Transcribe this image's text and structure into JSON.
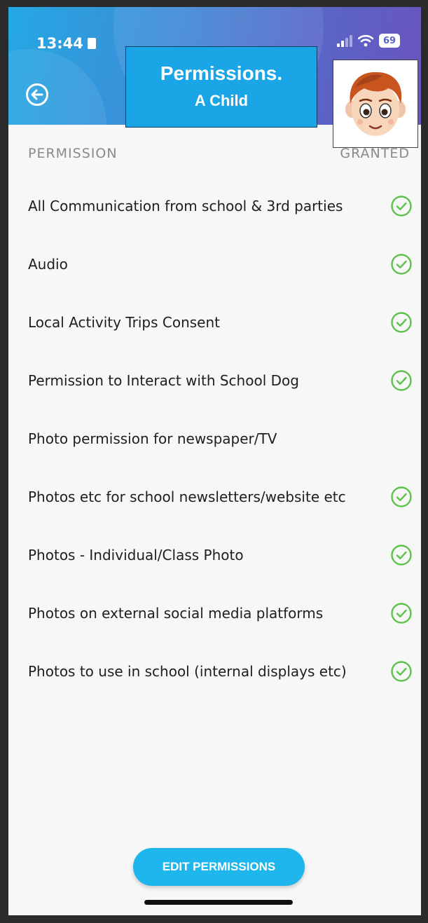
{
  "status_bar": {
    "time": "13:44",
    "battery": "69"
  },
  "header": {
    "title": "Permissions.",
    "subtitle": "A Child"
  },
  "list_header": {
    "left": "PERMISSION",
    "right": "GRANTED"
  },
  "permissions": [
    {
      "label": "All Communication from school & 3rd parties",
      "granted": true
    },
    {
      "label": "Audio",
      "granted": true
    },
    {
      "label": "Local Activity Trips Consent",
      "granted": true
    },
    {
      "label": "Permission to Interact with School Dog",
      "granted": true
    },
    {
      "label": "Photo permission for newspaper/TV",
      "granted": false
    },
    {
      "label": "Photos etc for school newsletters/website etc",
      "granted": true
    },
    {
      "label": "Photos - Individual/Class Photo",
      "granted": true
    },
    {
      "label": "Photos on external social media platforms",
      "granted": true
    },
    {
      "label": "Photos to use in school (internal displays etc)",
      "granted": true
    }
  ],
  "edit_button": {
    "label": "EDIT PERMISSIONS"
  },
  "colors": {
    "accent": "#1fb6ee",
    "check": "#5cc24a",
    "title_box": "#1aa5e6"
  },
  "icons": {
    "back": "back-arrow-circle-icon",
    "check": "check-circle-icon",
    "avatar": "child-cartoon-avatar"
  }
}
